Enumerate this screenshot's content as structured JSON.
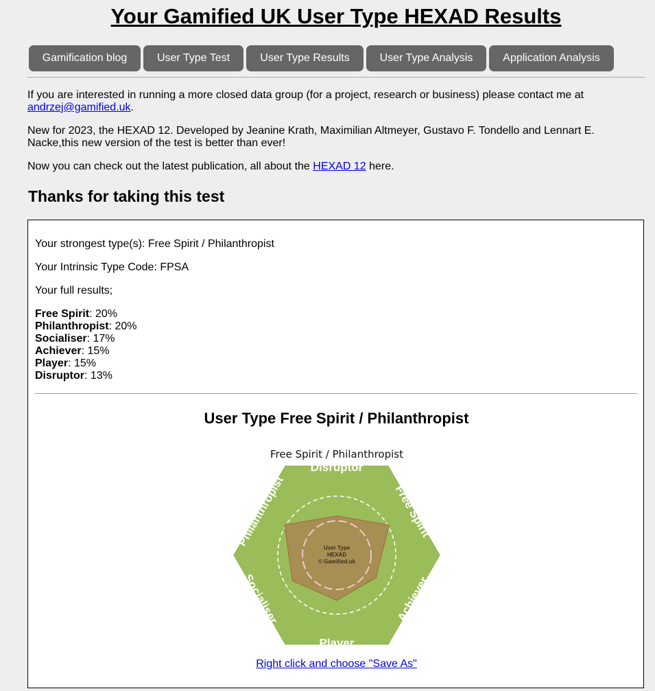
{
  "page": {
    "title": "Your Gamified UK User Type HEXAD Results"
  },
  "nav": {
    "items": [
      {
        "label": "Gamification blog"
      },
      {
        "label": "User Type Test"
      },
      {
        "label": "User Type Results"
      },
      {
        "label": "User Type Analysis"
      },
      {
        "label": "Application Analysis"
      }
    ]
  },
  "intro": {
    "contact_text": "If you are interested in running a more closed data group (for a project, research or business) please contact me at",
    "contact_email": "andrzej@gamified.uk",
    "contact_end": ".",
    "hexad12_line1": "New for 2023, the HEXAD 12. Developed by Jeanine Krath, Maximilian Altmeyer, Gustavo F. Tondello and Lennart E.",
    "hexad12_line2": "Nacke,this new version of the test is better than ever!",
    "publication_before": "Now you can check out the latest publication, all about the",
    "publication_link": "HEXAD 12",
    "publication_after": "here."
  },
  "thanks_heading": "Thanks for taking this test",
  "results": {
    "strongest": "Your strongest type(s): Free Spirit / Philanthropist",
    "intrinsic": "Your Intrinsic Type Code: FPSA",
    "full_label": "Your full results;",
    "scores": [
      {
        "name": "Free Spirit",
        "value": ": 20%"
      },
      {
        "name": "Philanthropist",
        "value": ": 20%"
      },
      {
        "name": "Socialiser",
        "value": ": 17%"
      },
      {
        "name": "Achiever",
        "value": ": 15%"
      },
      {
        "name": "Player",
        "value": ": 15%"
      },
      {
        "name": "Disruptor",
        "value": ": 13%"
      }
    ],
    "type_heading": "User Type Free Spirit / Philanthropist",
    "save_link": "Right click and choose \"Save As\""
  },
  "chart_data": {
    "type": "radar",
    "title": "Free Spirit / Philanthropist",
    "axes": [
      "Disruptor",
      "Free Spirit",
      "Achiever",
      "Player",
      "Socialiser",
      "Philanthropist"
    ],
    "values": [
      13,
      20,
      15,
      15,
      17,
      20
    ],
    "unit": "%",
    "center_text": [
      "User Type",
      "HEXAD",
      "© Gamified.uk"
    ],
    "colors": {
      "hex_fill": "#9bbd59",
      "hex_stroke": "#8aac4c",
      "polygon_fill": "#a98852",
      "polygon_stroke": "#9c6d3d",
      "ring": "#ffffff",
      "inner_ring": "#f1c9c9"
    }
  }
}
